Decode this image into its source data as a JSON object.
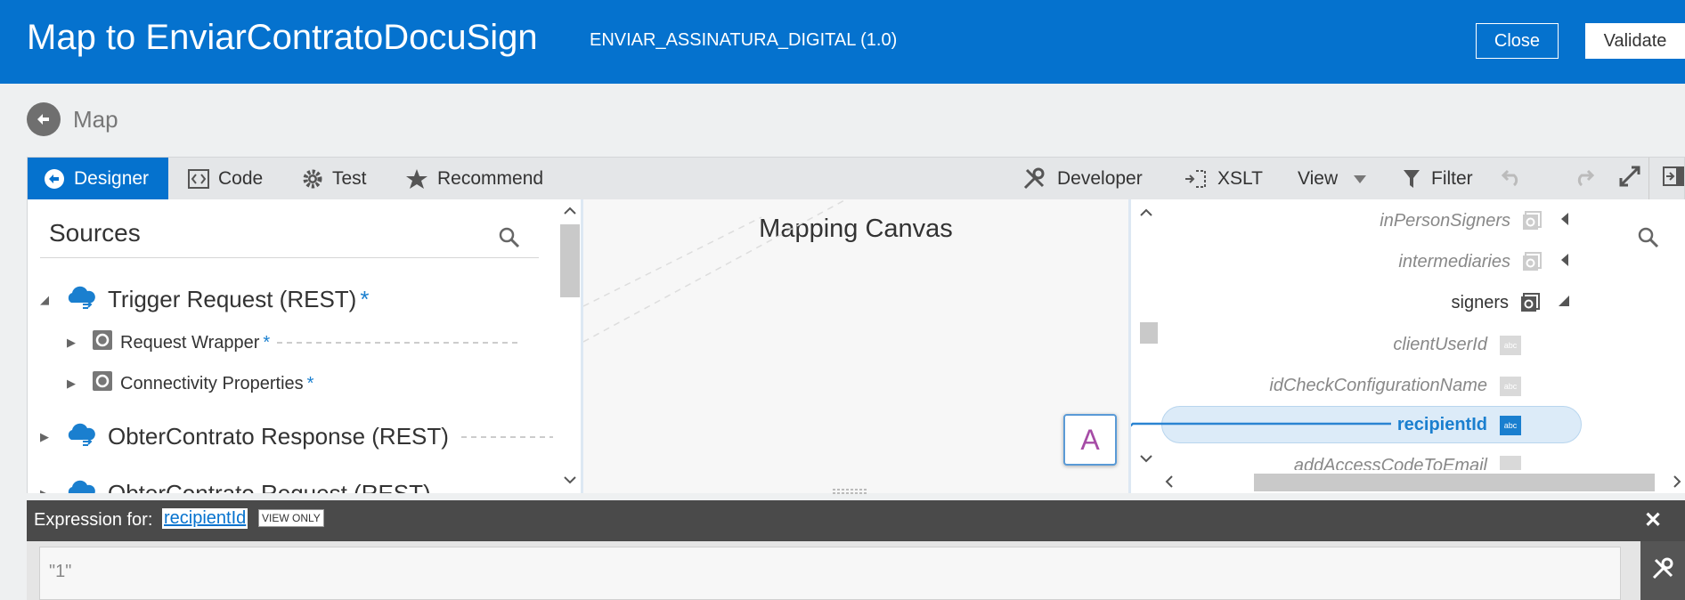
{
  "header": {
    "title": "Map to EnviarContratoDocuSign",
    "subtitle": "ENVIAR_ASSINATURA_DIGITAL (1.0)",
    "close_label": "Close",
    "validate_label": "Validate",
    "bg_color": "#0572ce"
  },
  "breadcrumb": {
    "label": "Map"
  },
  "toolbar": {
    "tabs": [
      {
        "label": "Designer",
        "icon": "designer-icon",
        "active": true
      },
      {
        "label": "Code",
        "icon": "code-icon"
      },
      {
        "label": "Test",
        "icon": "gear-icon"
      },
      {
        "label": "Recommend",
        "icon": "star-icon"
      }
    ],
    "tools": [
      {
        "label": "Developer",
        "icon": "wrench-icon"
      },
      {
        "label": "XSLT",
        "icon": "xslt-icon"
      },
      {
        "label": "View",
        "icon": "caret-down-icon"
      },
      {
        "label": "Filter",
        "icon": "filter-icon"
      }
    ]
  },
  "sources": {
    "title": "Sources",
    "items": [
      {
        "label": "Trigger Request (REST)",
        "required": "*"
      },
      {
        "label": "Request Wrapper",
        "required": "*"
      },
      {
        "label": "Connectivity Properties",
        "required": "*"
      },
      {
        "label": "ObterContrato Response (REST)"
      },
      {
        "label": "ObterContrato Request (REST)"
      }
    ]
  },
  "canvas": {
    "title": "Mapping Canvas",
    "node_letter": "A"
  },
  "target": {
    "items": [
      {
        "label": "inPersonSigners"
      },
      {
        "label": "intermediaries"
      },
      {
        "label": "signers"
      },
      {
        "label": "clientUserId",
        "type_badge": "abc"
      },
      {
        "label": "idCheckConfigurationName",
        "type_badge": "abc"
      },
      {
        "label": "recipientId",
        "type_badge": "abc"
      },
      {
        "label": "addAccessCodeToEmail"
      }
    ]
  },
  "expression": {
    "label": "Expression for:",
    "field": "recipientId",
    "badge": "VIEW ONLY",
    "value": "\"1\"",
    "close": "✕"
  }
}
